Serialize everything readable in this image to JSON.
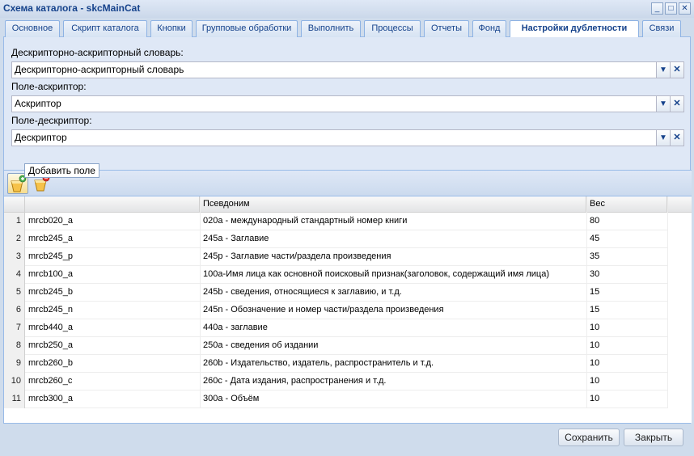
{
  "window": {
    "title": "Схема каталога - skcMainCat"
  },
  "tabs": [
    {
      "label": "Основное"
    },
    {
      "label": "Скрипт каталога"
    },
    {
      "label": "Кнопки"
    },
    {
      "label": "Групповые обработки"
    },
    {
      "label": "Выполнить"
    },
    {
      "label": "Процессы"
    },
    {
      "label": "Отчеты"
    },
    {
      "label": "Фонд"
    },
    {
      "label": "Настройки дублетности"
    },
    {
      "label": "Связи"
    }
  ],
  "form": {
    "dictionary": {
      "label": "Дескрипторно-аскрипторный словарь:",
      "value": "Дескрипторно-аскрипторный словарь"
    },
    "ascriptor": {
      "label": "Поле-аскриптор:",
      "value": "Аскриптор"
    },
    "descriptor": {
      "label": "Поле-дескриптор:",
      "value": "Дескриптор"
    }
  },
  "toolbar": {
    "tooltip": "Добавить поле"
  },
  "grid": {
    "headers": {
      "field": "",
      "alias": "Псевдоним",
      "weight": "Вес"
    },
    "rows": [
      {
        "num": "1",
        "field": "mrcb020_a",
        "alias": "020a - международный стандартный номер книги",
        "weight": "80"
      },
      {
        "num": "2",
        "field": "mrcb245_a",
        "alias": "245a - Заглавие",
        "weight": "45"
      },
      {
        "num": "3",
        "field": "mrcb245_p",
        "alias": "245p - Заглавие части/раздела произведения",
        "weight": "35"
      },
      {
        "num": "4",
        "field": "mrcb100_a",
        "alias": "100a-Имя лица как основной поисковый признак(заголовок, содержащий имя лица)",
        "weight": "30"
      },
      {
        "num": "5",
        "field": "mrcb245_b",
        "alias": "245b - сведения, относящиеся к заглавию, и т.д.",
        "weight": "15"
      },
      {
        "num": "6",
        "field": "mrcb245_n",
        "alias": "245n - Обозначение и номер части/раздела произведения",
        "weight": "15"
      },
      {
        "num": "7",
        "field": "mrcb440_a",
        "alias": "440a - заглавие",
        "weight": "10"
      },
      {
        "num": "8",
        "field": "mrcb250_a",
        "alias": "250a - сведения об издании",
        "weight": "10"
      },
      {
        "num": "9",
        "field": "mrcb260_b",
        "alias": "260b - Издательство, издатель, распространитель и т.д.",
        "weight": "10"
      },
      {
        "num": "10",
        "field": "mrcb260_c",
        "alias": "260c - Дата издания, распространения и т.д.",
        "weight": "10"
      },
      {
        "num": "11",
        "field": "mrcb300_a",
        "alias": "300a - Объём",
        "weight": "10"
      }
    ]
  },
  "footer": {
    "save_label": "Сохранить",
    "close_label": "Закрыть"
  }
}
